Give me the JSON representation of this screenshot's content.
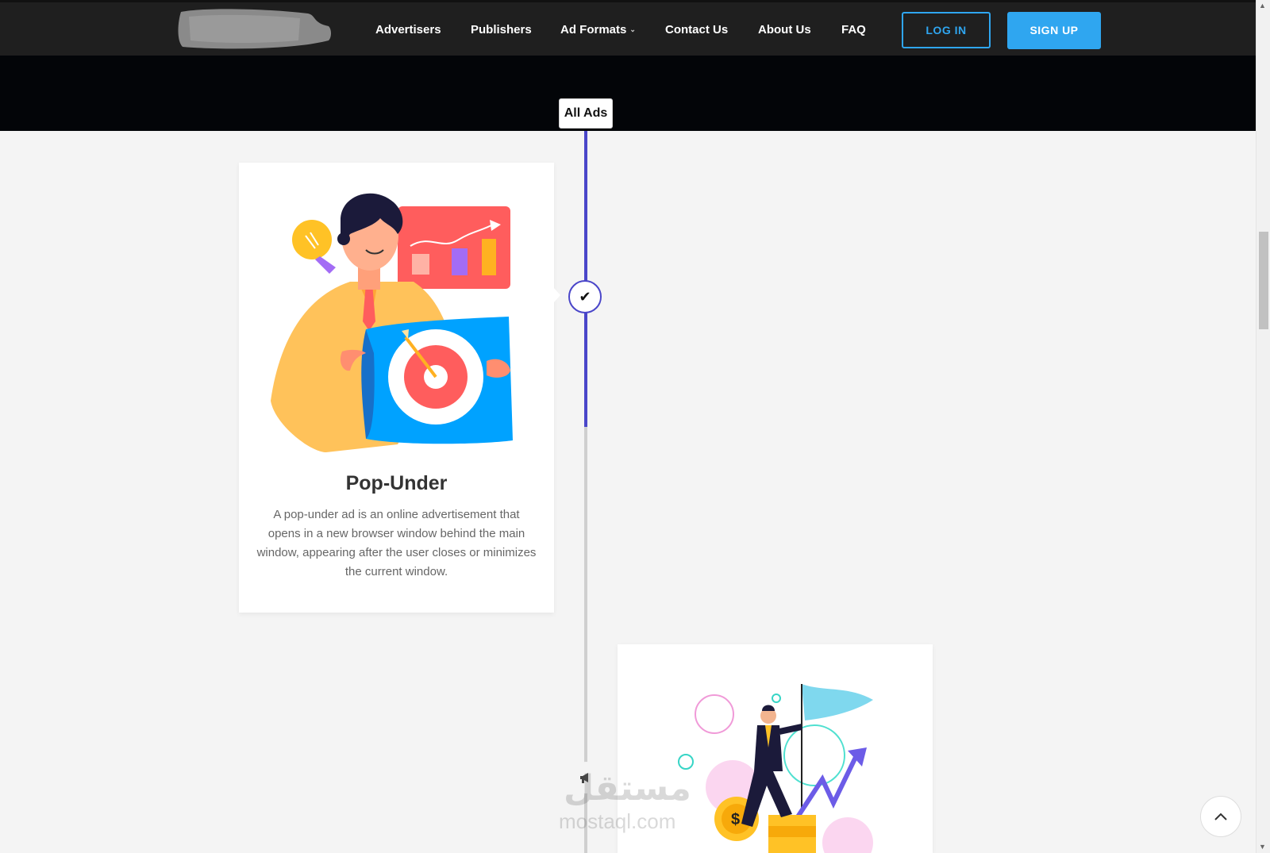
{
  "nav": {
    "links": [
      {
        "label": "Advertisers"
      },
      {
        "label": "Publishers"
      },
      {
        "label": "Ad Formats"
      },
      {
        "label": "Contact Us"
      },
      {
        "label": "About Us"
      },
      {
        "label": "FAQ"
      }
    ],
    "login_label": "LOG IN",
    "signup_label": "SIGN UP"
  },
  "timeline": {
    "tab_label": "All Ads",
    "cards": [
      {
        "title": "Pop-Under",
        "description": "A pop-under ad is an online advertisement that opens in a new browser window behind the main window, appearing after the user closes or minimizes the current window."
      }
    ]
  },
  "watermark": {
    "arabic": "مستقل",
    "latin": "mostaql.com"
  },
  "colors": {
    "nav_bg": "#1f1f1f",
    "accent_blue": "#2fa6f0",
    "timeline_active": "#4a46c9",
    "page_bg": "#f4f4f4"
  },
  "icons": {
    "timeline_node": "check-icon",
    "timeline_node_2": "megaphone-icon",
    "back_to_top": "chevron-up-icon"
  }
}
